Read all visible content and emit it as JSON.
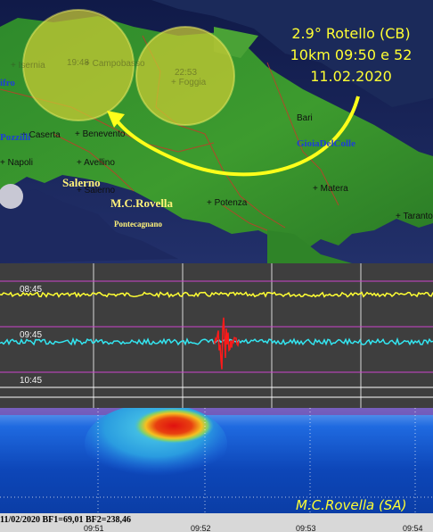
{
  "event": {
    "line1": "2.9° Rotello (CB)",
    "line2": "10km 09:50 e 52",
    "line3": "11.02.2020"
  },
  "map": {
    "cities": [
      {
        "name": "+ Isernia",
        "key": "isernia"
      },
      {
        "name": "+ Campobasso",
        "key": "campobasso"
      },
      {
        "name": "+ Foggia",
        "key": "foggia"
      },
      {
        "name": "+ Benevento",
        "key": "benevento"
      },
      {
        "name": "+ Caserta",
        "key": "caserta"
      },
      {
        "name": "+ Avellino",
        "key": "avellino"
      },
      {
        "name": "+ Napoli",
        "key": "napoli"
      },
      {
        "name": "+ Salerno",
        "key": "salerno-cross"
      },
      {
        "name": "+ Potenza",
        "key": "potenza"
      },
      {
        "name": "+ Matera",
        "key": "matera"
      },
      {
        "name": "+ Taranto",
        "key": "taranto"
      },
      {
        "name": "Bari",
        "key": "bari"
      }
    ],
    "circle_labels": {
      "left": "19:48",
      "right": "22:53"
    },
    "stations": {
      "gioia": "GioiaDelColle",
      "ozil": "Pozzilli",
      "ifro": "ifro",
      "salerno": "Salerno",
      "rovella": "M.C.Rovella",
      "pontecagnano": "Pontecagnano"
    }
  },
  "seismogram": {
    "labels": [
      "08:45",
      "09:45",
      "10:45"
    ],
    "trace_colors": {
      "upper": "#ffff33",
      "middle": "#33e5f0",
      "event": "#ff1a1a"
    }
  },
  "spectrogram": {
    "caption": "M.C.Rovella (SA)",
    "footer": "11/02/2020 BF1=69,01 BF2=238,46",
    "ticks": [
      "09:51",
      "09:52",
      "09:53",
      "09:54"
    ]
  }
}
